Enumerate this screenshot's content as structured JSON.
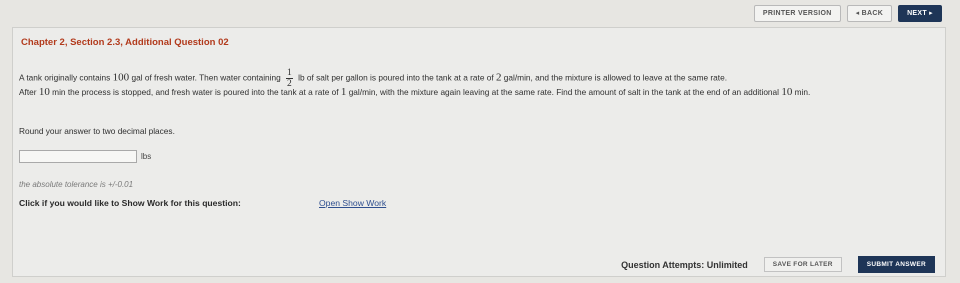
{
  "topbar": {
    "printer_version": "PRINTER VERSION",
    "back": "◂ BACK",
    "next": "NEXT ▸"
  },
  "question": {
    "title": "Chapter 2, Section 2.3, Additional Question 02",
    "line1_a": "A tank originally contains",
    "line1_n1": "100",
    "line1_b": "gal of fresh water. Then water containing",
    "frac_num": "1",
    "frac_den": "2",
    "line1_c": "lb of salt per gallon is poured into the tank at a rate of",
    "line1_n2": "2",
    "line1_d": "gal/min, and the mixture is allowed to leave at the same rate.",
    "line2_a": "After",
    "line2_n1": "10",
    "line2_b": "min the process is stopped, and fresh water is poured into the tank at a rate of",
    "line2_n2": "1",
    "line2_c": "gal/min, with the mixture again leaving at the same rate. Find the amount of salt in the tank at the end of an additional",
    "line2_n3": "10",
    "line2_d": "min.",
    "round_text": "Round your answer to two decimal places."
  },
  "answer": {
    "value": "",
    "unit": "lbs",
    "tolerance": "the absolute tolerance is +/-0.01"
  },
  "show_work": {
    "prompt": "Click if you would like to Show Work for this question:",
    "link": "Open Show Work"
  },
  "footer": {
    "attempts": "Question Attempts: Unlimited",
    "save": "SAVE FOR LATER",
    "submit": "SUBMIT ANSWER"
  }
}
